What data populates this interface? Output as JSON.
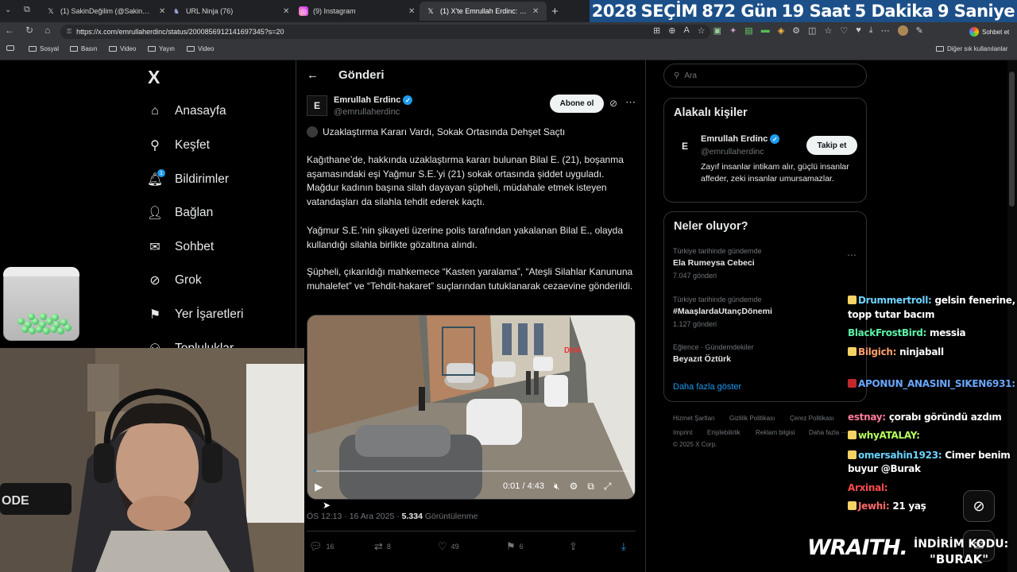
{
  "browser": {
    "tabs": [
      {
        "icon": "x-logo-icon",
        "label": "(1) SakinDeğilim (@SakinOlmaBur..."
      },
      {
        "icon": "ninja-icon",
        "label": "URL Ninja (76)"
      },
      {
        "icon": "instagram-icon",
        "label": "(9) Instagram"
      },
      {
        "icon": "x-logo-icon",
        "label": "(1) X'te Emrullah Erdinc: \"🔴 Uzakl..."
      }
    ],
    "new_tab": "+",
    "url": "https://x.com/emrullaherdinc/status/2000856912141697345?s=20",
    "chat_button": "Sohbet et",
    "bookmarks": [
      "Sosyal",
      "Basın",
      "Video",
      "Yayın",
      "Video"
    ],
    "other_bookmarks": "Diğer sık kullanılanlar"
  },
  "countdown": {
    "year": "2028",
    "label": "SEÇİM",
    "days": "872 Gün",
    "hours": "19 Saat",
    "minutes": "5 Dakika",
    "seconds": "9 Saniye"
  },
  "sidebar": {
    "logo": "X",
    "items": [
      {
        "label": "Anasayfa",
        "icon": "home-icon"
      },
      {
        "label": "Keşfet",
        "icon": "search-icon"
      },
      {
        "label": "Bildirimler",
        "icon": "bell-icon",
        "badge": "1"
      },
      {
        "label": "Bağlan",
        "icon": "add-person-icon"
      },
      {
        "label": "Sohbet",
        "icon": "mail-icon"
      },
      {
        "label": "Grok",
        "icon": "grok-icon"
      },
      {
        "label": "Yer İşaretleri",
        "icon": "bookmark-icon"
      },
      {
        "label": "Topluluklar",
        "icon": "communities-icon"
      }
    ]
  },
  "post": {
    "header_title": "Gönderi",
    "author_name": "Emrullah Erdinc",
    "author_handle": "@emrullaherdinc",
    "subscribe_label": "Abone ol",
    "headline": "Uzaklaştırma Kararı Vardı, Sokak Ortasında Dehşet Saçtı",
    "paragraphs": [
      "Kağıthane’de, hakkında uzaklaştırma kararı bulunan Bilal E. (21), boşanma aşamasındaki eşi Yağmur S.E.’yi (21) sokak ortasında şiddet uyguladı.  Mağdur kadının başına silah dayayan şüpheli, müdahale etmek isteyen vatandaşları da silahla tehdit ederek kaçtı.",
      "Yağmur S.E.’nin şikayeti üzerine polis tarafından yakalanan Bilal E., olayda kullandığı silahla birlikte gözaltına alındı.",
      "Şüpheli, çıkarıldığı mahkemece “Kasten yaralama”, “Ateşli Silahlar Kanununa muhalefet” ve “Tehdit-hakaret” suçlarından tutuklanarak cezaevine gönderildi."
    ],
    "video": {
      "watermark": "DHA",
      "time": "0:01 / 4:43",
      "progress": 0.004
    },
    "time_date": "ÖS 12:13 · 16 Ara 2025 · ",
    "views": "5.334",
    "views_label": " Görüntülenme",
    "actions": {
      "replies": "16",
      "reposts": "8",
      "likes": "49",
      "bookmarks": "6"
    }
  },
  "right": {
    "search_placeholder": "Ara",
    "related_title": "Alakalı kişiler",
    "related": {
      "name": "Emrullah Erdinc",
      "handle": "@emrullaherdinc",
      "follow_label": "Takip et",
      "bio": "Zayıf insanlar intikam alır, güçlü insanlar affeder, zeki insanlar umursamazlar."
    },
    "trends_title": "Neler oluyor?",
    "trends": [
      {
        "category": "Türkiye tarihinde gündemde",
        "name": "Ela Rumeysa Cebeci",
        "count": "7.047 gönderi"
      },
      {
        "category": "Türkiye tarihinde gündemde",
        "name": "#MaaşlardaUtançDönemi",
        "count": "1.127 gönderi"
      },
      {
        "category": "Eğlence · Gündemdekiler",
        "name": "Beyazıt Öztürk",
        "count": ""
      }
    ],
    "show_more": "Daha fazla göster",
    "footer": [
      "Hizmet Şartları",
      "Gizlilik Politikası",
      "Çerez Politikası",
      "Imprint",
      "Erişilebilirlik",
      "Reklam bilgisi",
      "Daha fazla ···",
      "© 2025 X Corp."
    ]
  },
  "stream_chat": [
    {
      "user": "Drummertroll:",
      "msg": "gelsin fenerine,",
      "color": "#6dd3ff",
      "badge": "#f6d365"
    },
    {
      "user": "",
      "msg": "topp tutar bacım",
      "color": "#fff",
      "badge": ""
    },
    {
      "user": "BlackFrostBird:",
      "msg": "messia",
      "color": "#5ef2a8",
      "badge": ""
    },
    {
      "user": "Bilgich:",
      "msg": "ninjaball",
      "color": "#ff9f6b",
      "badge": "#f6d365"
    },
    {
      "user": "APONUN_ANASINI_SIKEN6931:",
      "msg": "",
      "color": "#6aa8ff",
      "badge": "#c0282d"
    },
    {
      "user": "estnay:",
      "msg": "çorabı göründü azdım",
      "color": "#ff7b9c",
      "badge": ""
    },
    {
      "user": "whyATALAY:",
      "msg": "",
      "color": "#b8ff5e",
      "badge": "#f6d365"
    },
    {
      "user": "omersahin1923:",
      "msg": "Cimer benim",
      "color": "#69d3ff",
      "badge": "#f6d365"
    },
    {
      "user": "",
      "msg": "buyur @Burak",
      "color": "#fff",
      "badge": ""
    },
    {
      "user": "Arxinal:",
      "msg": "",
      "color": "#ff4a4a",
      "badge": ""
    },
    {
      "user": "Jewhi:",
      "msg": "21 yaş",
      "color": "#ff6b6b",
      "badge": "#f6d365"
    }
  ],
  "overlay": {
    "sponsor": "WRAITH.",
    "promo_line1": "İNDİRİM KODU:",
    "promo_line2": "\"BURAK\"",
    "webcam_mic_label": "ODE"
  }
}
